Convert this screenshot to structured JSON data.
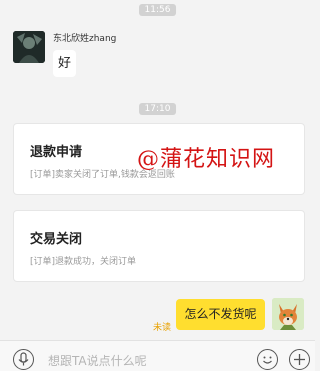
{
  "messages": {
    "time_1": "11:56",
    "time_2": "17:10",
    "seller_name": "东北欣姓zhang",
    "seller_text": "好",
    "buyer_text": "怎么不发货呢",
    "buyer_status": "未读"
  },
  "cards": [
    {
      "title": "退款申请",
      "desc": "[订单]卖家关闭了订单,钱款会返回账"
    },
    {
      "title": "交易关闭",
      "desc": "[订单]退款成功，关闭订单"
    }
  ],
  "watermark": "@蒲花知识网",
  "input": {
    "placeholder": "想跟TA说点什么呢"
  },
  "icons": {
    "voice": "microphone-icon",
    "emoji": "smiley-icon",
    "more": "plus-icon"
  },
  "colors": {
    "buyer_bubble": "#ffde2f",
    "unread": "#e8a100",
    "watermark": "#d41414"
  }
}
